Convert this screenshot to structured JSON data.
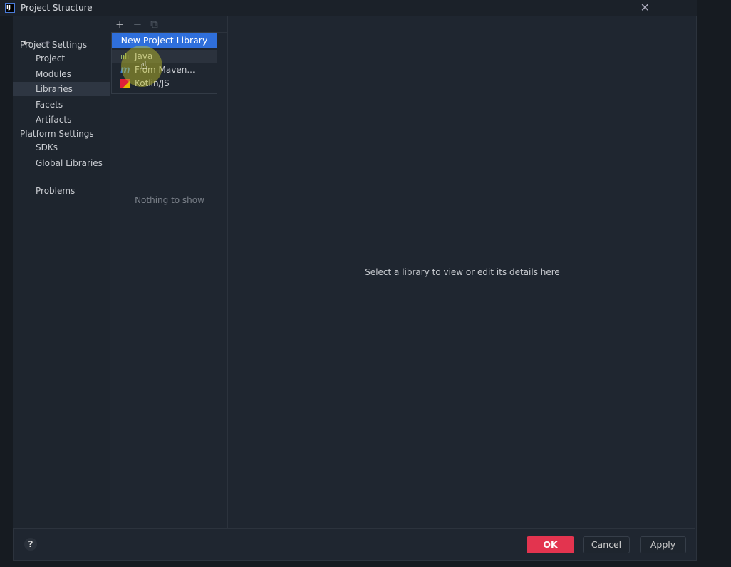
{
  "window": {
    "title": "Project Structure",
    "logo": "IJ",
    "close_icon": "close-icon"
  },
  "sidebar": {
    "items": [
      {
        "label": "Project Settings",
        "type": "header"
      },
      {
        "label": "Project"
      },
      {
        "label": "Modules"
      },
      {
        "label": "Libraries",
        "selected": true
      },
      {
        "label": "Facets"
      },
      {
        "label": "Artifacts"
      },
      {
        "label": "Platform Settings",
        "type": "header"
      },
      {
        "label": "SDKs"
      },
      {
        "label": "Global Libraries"
      },
      {
        "label": "Problems"
      }
    ]
  },
  "libraries": {
    "empty_text": "Nothing to show"
  },
  "popup": {
    "header": "New Project Library",
    "items": [
      {
        "label": "Java",
        "icon": "java-library-icon"
      },
      {
        "label": "From Maven...",
        "icon": "maven-icon"
      },
      {
        "label": "Kotlin/JS",
        "icon": "kotlin-js-icon"
      }
    ]
  },
  "detail": {
    "placeholder": "Select a library to view or edit its details here"
  },
  "footer": {
    "help": "?",
    "ok": "OK",
    "cancel": "Cancel",
    "apply": "Apply"
  },
  "colors": {
    "accent": "#2f6fdb",
    "ok": "#e3344f"
  }
}
